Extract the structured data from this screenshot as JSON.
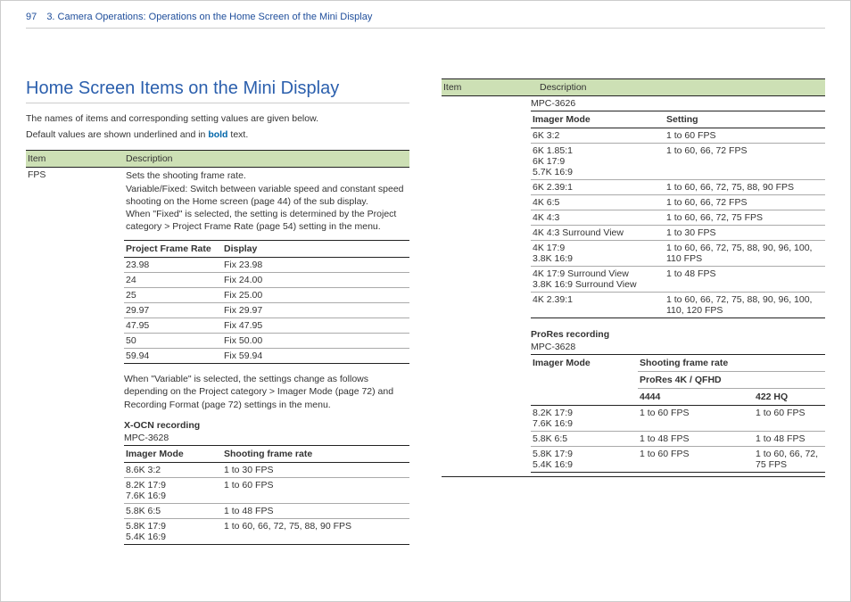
{
  "pageNumber": "97",
  "breadcrumb": "3. Camera Operations: Operations on the Home Screen of the Mini Display",
  "sectionTitle": "Home Screen Items on the Mini Display",
  "intro1": "The names of items and corresponding setting values are given below.",
  "intro2a": "Default values are shown underlined and in ",
  "intro2b": "bold",
  "intro2c": " text.",
  "mainHdr": {
    "c1": "Item",
    "c2": "Description"
  },
  "fpsLabel": "FPS",
  "fpsDesc1": "Sets the shooting frame rate.",
  "fpsDesc2": "Variable/Fixed: Switch between variable speed and constant speed shooting on the Home screen (page 44) of the sub display.",
  "fpsDesc3": "When \"Fixed\" is selected, the setting is determined by the Project category > Project Frame Rate (page 54) setting in the menu.",
  "frameTable": {
    "hdr": {
      "c1": "Project Frame Rate",
      "c2": "Display"
    },
    "rows": [
      {
        "c1": "23.98",
        "c2": "Fix 23.98"
      },
      {
        "c1": "24",
        "c2": "Fix 24.00"
      },
      {
        "c1": "25",
        "c2": "Fix 25.00"
      },
      {
        "c1": "29.97",
        "c2": "Fix 29.97"
      },
      {
        "c1": "47.95",
        "c2": "Fix 47.95"
      },
      {
        "c1": "50",
        "c2": "Fix 50.00"
      },
      {
        "c1": "59.94",
        "c2": "Fix 59.94"
      }
    ]
  },
  "variableNote": "When \"Variable\" is selected, the settings change as follows depending on the Project category > Imager Mode (page 72) and Recording Format (page 72) settings in the menu.",
  "xocn": {
    "title": "X-OCN recording",
    "model": "MPC-3628",
    "hdr": {
      "c1": "Imager Mode",
      "c2": "Shooting frame rate"
    },
    "rows": [
      {
        "c1a": "8.6K 3:2",
        "c1b": "",
        "c2": "1 to 30 FPS"
      },
      {
        "c1a": "8.2K 17:9",
        "c1b": "7.6K 16:9",
        "c2": "1 to 60 FPS"
      },
      {
        "c1a": "5.8K 6:5",
        "c1b": "",
        "c2": "1 to 48 FPS"
      },
      {
        "c1a": "5.8K 17:9",
        "c1b": "5.4K 16:9",
        "c2": "1 to 60, 66, 72, 75, 88, 90 FPS"
      }
    ]
  },
  "rightHdr": {
    "c1": "Item",
    "c2": "Description"
  },
  "mpc3626": {
    "model": "MPC-3626",
    "hdr": {
      "c1": "Imager Mode",
      "c2": "Setting"
    },
    "rows": [
      {
        "c1a": "6K 3:2",
        "c1b": "",
        "c2": "1 to 60 FPS"
      },
      {
        "c1a": "6K 1.85:1",
        "c1b": "6K 17:9",
        "c1c": "5.7K 16:9",
        "c2": "1 to 60, 66, 72 FPS"
      },
      {
        "c1a": "6K 2.39:1",
        "c1b": "",
        "c2": "1 to 60, 66, 72, 75, 88, 90 FPS"
      },
      {
        "c1a": "4K 6:5",
        "c1b": "",
        "c2": "1 to 60, 66, 72 FPS"
      },
      {
        "c1a": "4K 4:3",
        "c1b": "",
        "c2": "1 to 60, 66, 72, 75 FPS"
      },
      {
        "c1a": "4K 4:3 Surround View",
        "c1b": "",
        "c2": "1 to 30 FPS"
      },
      {
        "c1a": "4K 17:9",
        "c1b": "3.8K 16:9",
        "c2": "1 to 60, 66, 72, 75, 88, 90, 96, 100, 110 FPS"
      },
      {
        "c1a": "4K 17:9 Surround View",
        "c1b": "3.8K 16:9 Surround View",
        "c2": "1 to 48 FPS"
      },
      {
        "c1a": "4K 2.39:1",
        "c1b": "",
        "c2": "1 to 60, 66, 72, 75, 88, 90, 96, 100, 110, 120 FPS"
      }
    ]
  },
  "prores": {
    "title": "ProRes recording",
    "model": "MPC-3628",
    "hdrTop": {
      "c1": "Imager Mode",
      "c2": "Shooting frame rate"
    },
    "hdrSub": {
      "span": "ProRes 4K / QFHD",
      "c2": "4444",
      "c3": "422 HQ"
    },
    "rows": [
      {
        "c1a": "8.2K 17:9",
        "c1b": "7.6K 16:9",
        "c2": "1 to 60 FPS",
        "c3": "1 to 60 FPS"
      },
      {
        "c1a": "5.8K 6:5",
        "c1b": "",
        "c2": "1 to 48 FPS",
        "c3": "1 to 48 FPS"
      },
      {
        "c1a": "5.8K 17:9",
        "c1b": "5.4K 16:9",
        "c2": "1 to 60 FPS",
        "c3": "1 to 60, 66, 72, 75 FPS"
      }
    ]
  }
}
